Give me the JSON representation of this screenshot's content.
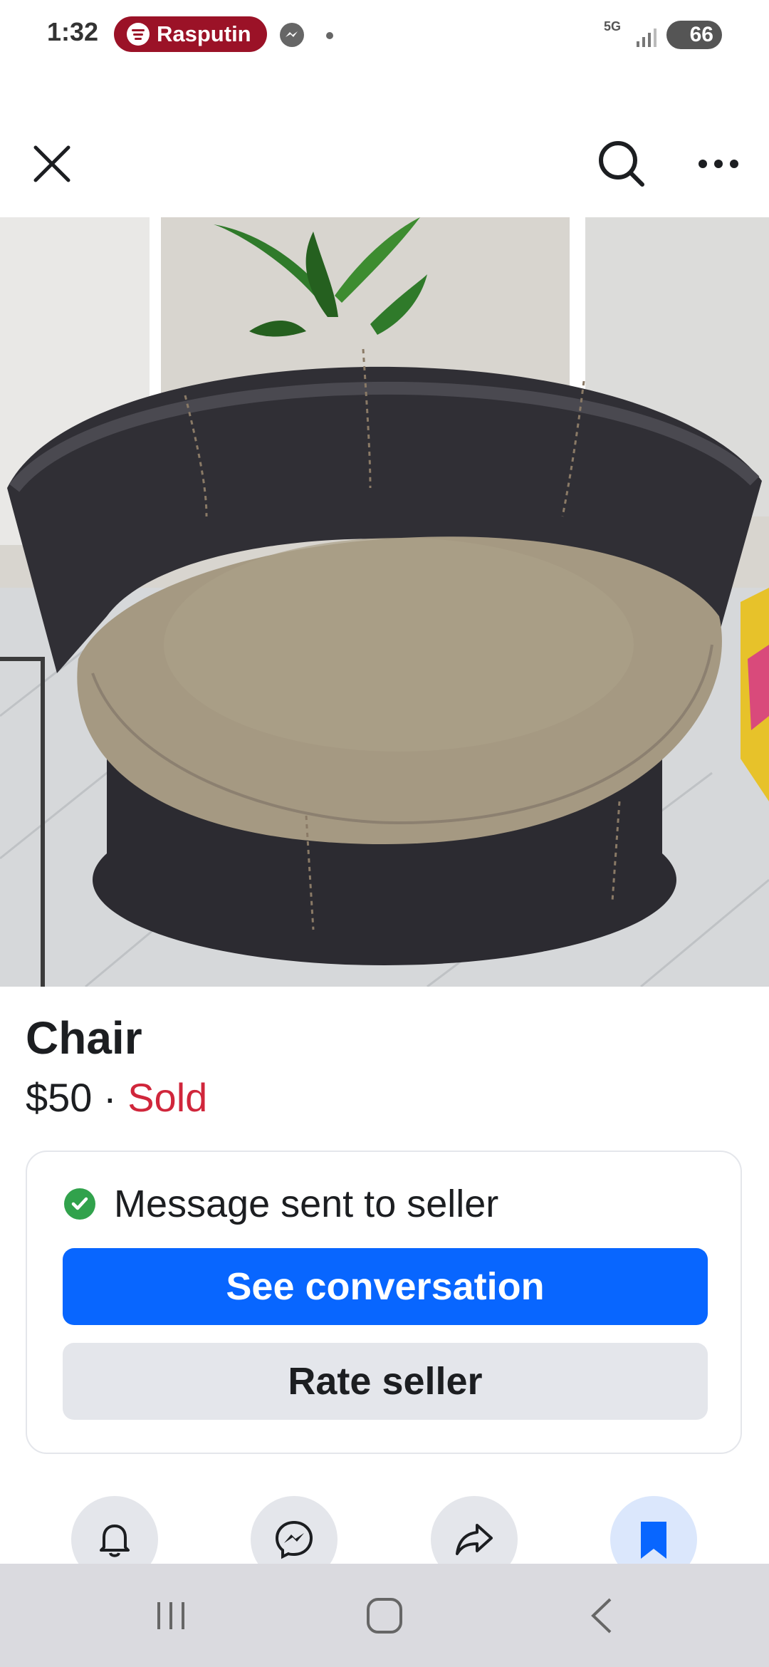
{
  "status_bar": {
    "time": "1:32",
    "now_playing": "Rasputin",
    "network": "5G",
    "battery": "66"
  },
  "icons": {
    "close": "close-icon",
    "search": "search-icon",
    "more": "more-icon",
    "notify": "bell-icon",
    "message": "messenger-icon",
    "share": "share-icon",
    "save": "bookmark-icon"
  },
  "listing": {
    "title": "Chair",
    "price": "$50",
    "separator": " · ",
    "status": "Sold"
  },
  "message_card": {
    "status_text": "Message sent to seller",
    "primary_button": "See conversation",
    "secondary_button": "Rate seller"
  },
  "colors": {
    "primary": "#0866ff",
    "sold": "#d0263b",
    "success": "#31a24c",
    "spotify_pill": "#9b1227"
  }
}
